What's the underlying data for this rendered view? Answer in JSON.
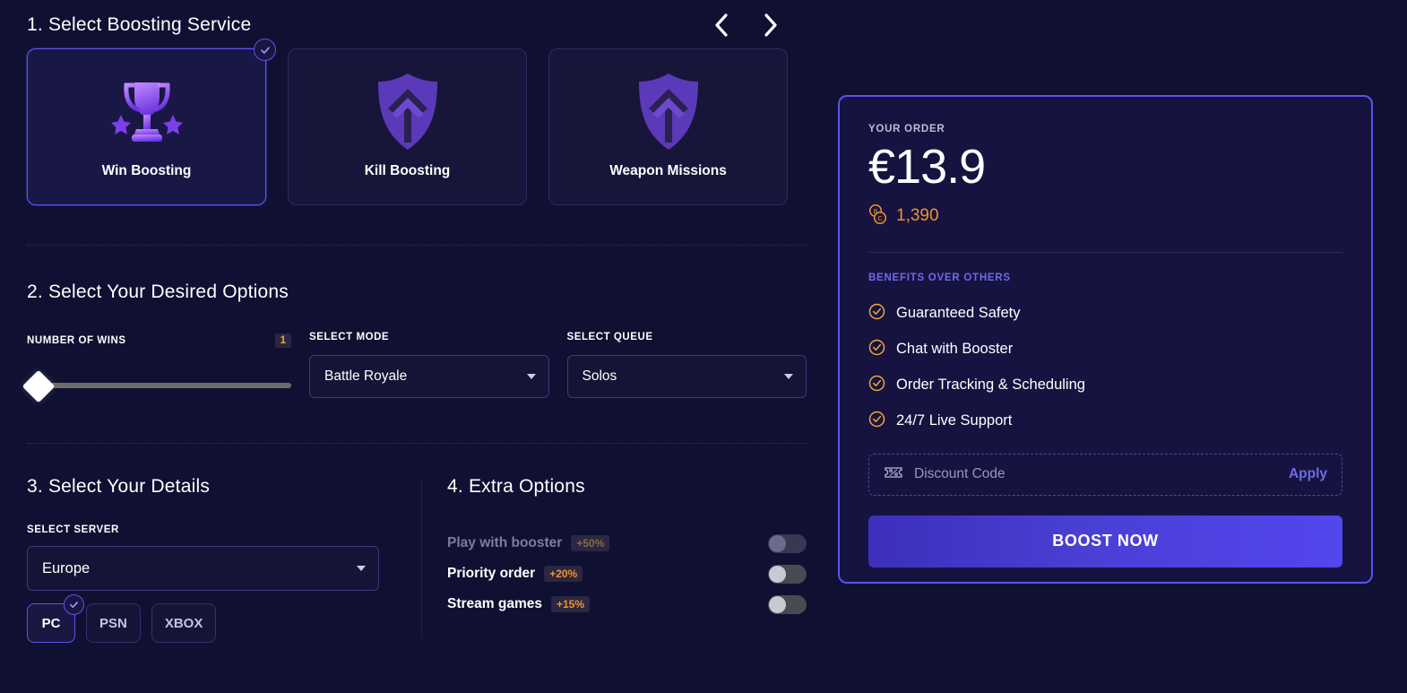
{
  "step1": {
    "title": "1. Select Boosting Service",
    "prev_icon": "chevron-left-icon",
    "next_icon": "chevron-right-icon",
    "cards": [
      {
        "label": "Win Boosting",
        "icon": "trophy-icon",
        "selected": true
      },
      {
        "label": "Kill Boosting",
        "icon": "shield-arrow-icon",
        "selected": false
      },
      {
        "label": "Weapon Missions",
        "icon": "shield-arrow-icon",
        "selected": false
      }
    ]
  },
  "step2": {
    "title": "2. Select Your Desired Options",
    "wins": {
      "label": "NUMBER OF WINS",
      "value": "1",
      "slider_position_pct": 0
    },
    "mode": {
      "label": "SELECT MODE",
      "value": "Battle Royale"
    },
    "queue": {
      "label": "SELECT QUEUE",
      "value": "Solos"
    }
  },
  "step3": {
    "title": "3. Select Your Details",
    "server": {
      "label": "SELECT SERVER",
      "value": "Europe"
    },
    "platforms": [
      {
        "label": "PC",
        "selected": true
      },
      {
        "label": "PSN",
        "selected": false
      },
      {
        "label": "XBOX",
        "selected": false
      }
    ]
  },
  "step4": {
    "title": "4. Extra Options",
    "options": [
      {
        "label": "Play with booster",
        "percent": "+50%",
        "enabled": false,
        "on": false
      },
      {
        "label": "Priority order",
        "percent": "+20%",
        "enabled": true,
        "on": false
      },
      {
        "label": "Stream games",
        "percent": "+15%",
        "enabled": true,
        "on": false
      }
    ]
  },
  "order": {
    "kicker": "YOUR ORDER",
    "price": "€13.9",
    "coins": "1,390",
    "coin_icon": "coins-icon",
    "benefits_kicker": "BENEFITS OVER OTHERS",
    "benefits": [
      "Guaranteed Safety",
      "Chat with Booster",
      "Order Tracking & Scheduling",
      "24/7 Live Support"
    ],
    "discount": {
      "icon": "coupon-percent-icon",
      "value": "",
      "placeholder": "Discount Code",
      "apply_label": "Apply"
    },
    "cta_label": "BOOST NOW"
  },
  "colors": {
    "page_bg": "#101033",
    "accent": "#5b53ef",
    "gold": "#f0932a",
    "panel_bg": "#161340"
  }
}
